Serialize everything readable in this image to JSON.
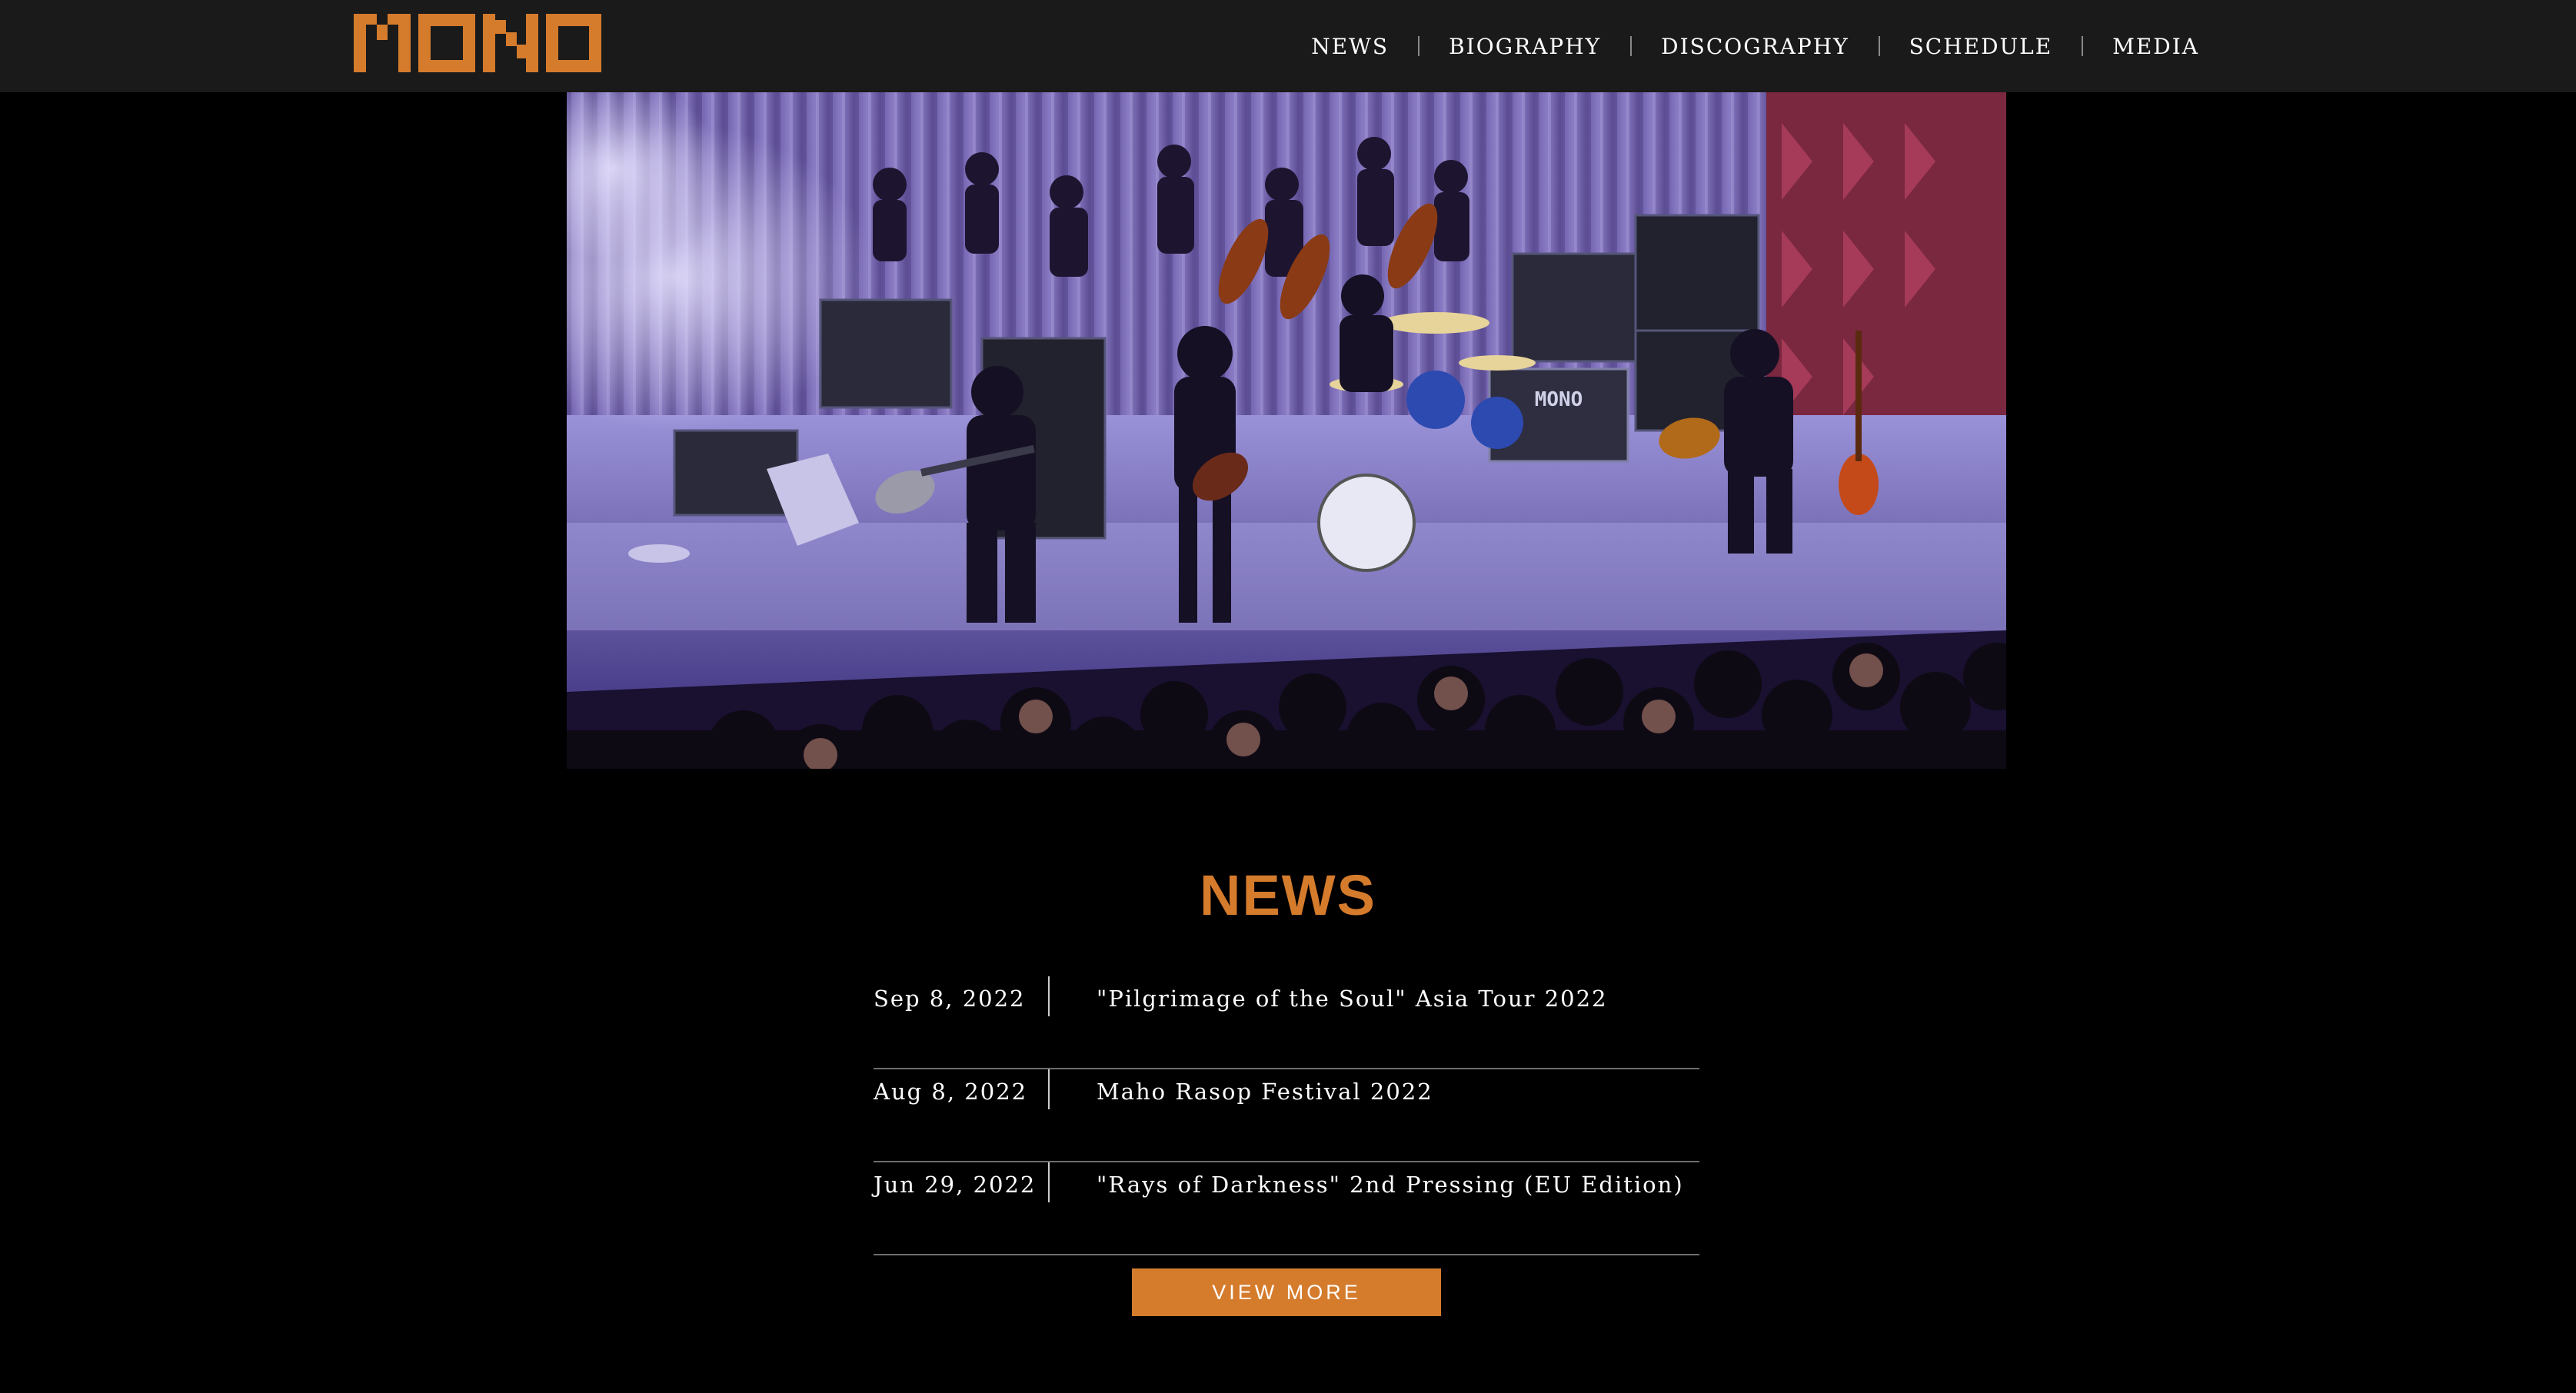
{
  "header": {
    "logo_text": "MONO",
    "nav": [
      {
        "label": "NEWS"
      },
      {
        "label": "BIOGRAPHY"
      },
      {
        "label": "DISCOGRAPHY"
      },
      {
        "label": "SCHEDULE"
      },
      {
        "label": "MEDIA"
      }
    ]
  },
  "hero": {
    "stage_case_label": "MONO"
  },
  "news": {
    "title": "NEWS",
    "items": [
      {
        "date": "Sep 8, 2022",
        "headline": "\"Pilgrimage of the Soul\" Asia Tour 2022"
      },
      {
        "date": "Aug 8, 2022",
        "headline": "Maho Rasop Festival 2022"
      },
      {
        "date": "Jun 29, 2022",
        "headline": "\"Rays of Darkness\" 2nd Pressing (EU Edition)"
      }
    ],
    "view_more_label": "VIEW MORE"
  },
  "colors": {
    "accent": "#d57b2c",
    "header_bg": "#1a1a1a",
    "page_bg": "#000000"
  }
}
